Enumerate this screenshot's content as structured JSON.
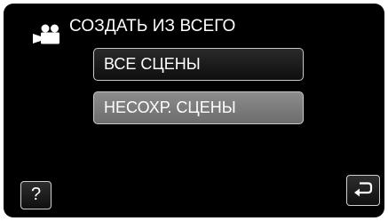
{
  "header": {
    "mode_icon": "video-camera-icon",
    "title": "СОЗДАТЬ ИЗ ВСЕГО"
  },
  "menu": {
    "items": [
      {
        "label": "ВСЕ СЦЕНЫ",
        "state": "normal"
      },
      {
        "label": "НЕСОХР. СЦЕНЫ",
        "state": "highlighted"
      }
    ]
  },
  "footer": {
    "help_label": "?",
    "back_icon": "return-arrow-icon"
  },
  "colors": {
    "background": "#000000",
    "text": "#ffffff",
    "button_border": "#c8c8c8",
    "highlight": "#7d7d7d"
  }
}
